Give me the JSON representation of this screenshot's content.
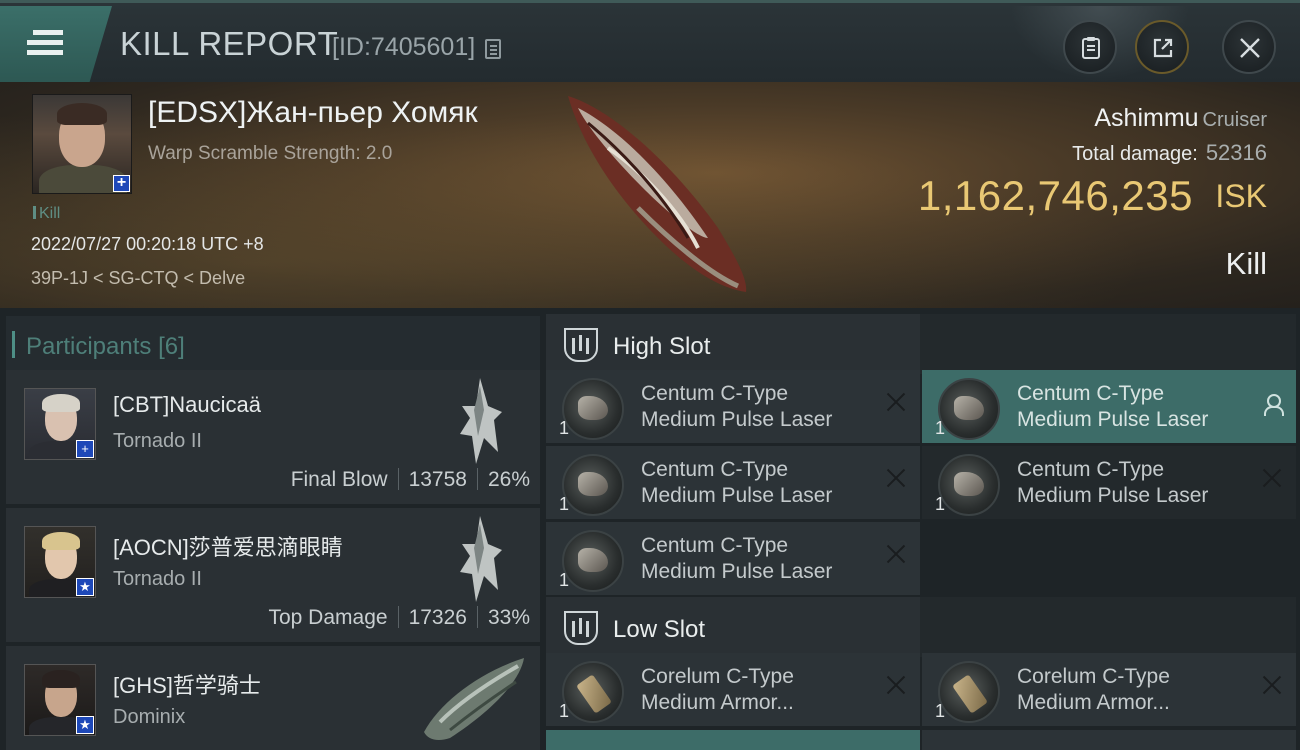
{
  "titlebar": {
    "title": "KILL REPORT",
    "report_id": "[ID:7405601]"
  },
  "victim": {
    "name": "[EDSX]Жан-пьер Хомяк",
    "warp_scramble": "Warp Scramble Strength: 2.0",
    "tag": "Kill",
    "datetime": "2022/07/27 00:20:18 UTC +8",
    "location": "39P-1J < SG-CTQ < Delve",
    "badge": "+"
  },
  "ship": {
    "name": "Ashimmu",
    "class": "Cruiser",
    "total_damage_label": "Total damage:",
    "total_damage": "52316",
    "isk_value": "1,162,746,235",
    "isk_unit": "ISK",
    "status": "Kill"
  },
  "participants": {
    "header": "Participants",
    "count": "[6]",
    "rows": [
      {
        "name": "[CBT]Naucicaä",
        "ship": "Tornado II",
        "role": "Final Blow",
        "damage": "13758",
        "percent": "26%",
        "badge": "+"
      },
      {
        "name": "[AOCN]莎普爱思滴眼睛",
        "ship": "Tornado II",
        "role": "Top Damage",
        "damage": "17326",
        "percent": "33%",
        "badge": "★"
      },
      {
        "name": "[GHS]哲学骑士",
        "ship": "Dominix",
        "badge": "★"
      }
    ]
  },
  "fitting": {
    "high_slot": {
      "title": "High Slot",
      "modules": [
        {
          "qty": "1",
          "line1": "Centum C-Type",
          "line2": "Medium Pulse Laser"
        },
        {
          "qty": "1",
          "line1": "Centum C-Type",
          "line2": "Medium Pulse Laser"
        },
        {
          "qty": "1",
          "line1": "Centum C-Type",
          "line2": "Medium Pulse Laser"
        },
        {
          "qty": "1",
          "line1": "Centum C-Type",
          "line2": "Medium Pulse Laser"
        },
        {
          "qty": "1",
          "line1": "Centum C-Type",
          "line2": "Medium Pulse Laser"
        }
      ]
    },
    "low_slot": {
      "title": "Low Slot",
      "modules": [
        {
          "qty": "1",
          "line1": "Corelum C-Type",
          "line2": "Medium Armor..."
        },
        {
          "qty": "1",
          "line1": "Corelum C-Type",
          "line2": "Medium Armor..."
        }
      ]
    }
  },
  "colors": {
    "accent_teal": "#3d6c68",
    "isk_gold": "#e9c874",
    "badge_blue": "#1e48b8"
  },
  "icons": [
    "menu-icon",
    "copy-icon",
    "clipboard-icon",
    "share-icon",
    "close-icon",
    "slot-icon",
    "remove-icon",
    "person-icon"
  ]
}
